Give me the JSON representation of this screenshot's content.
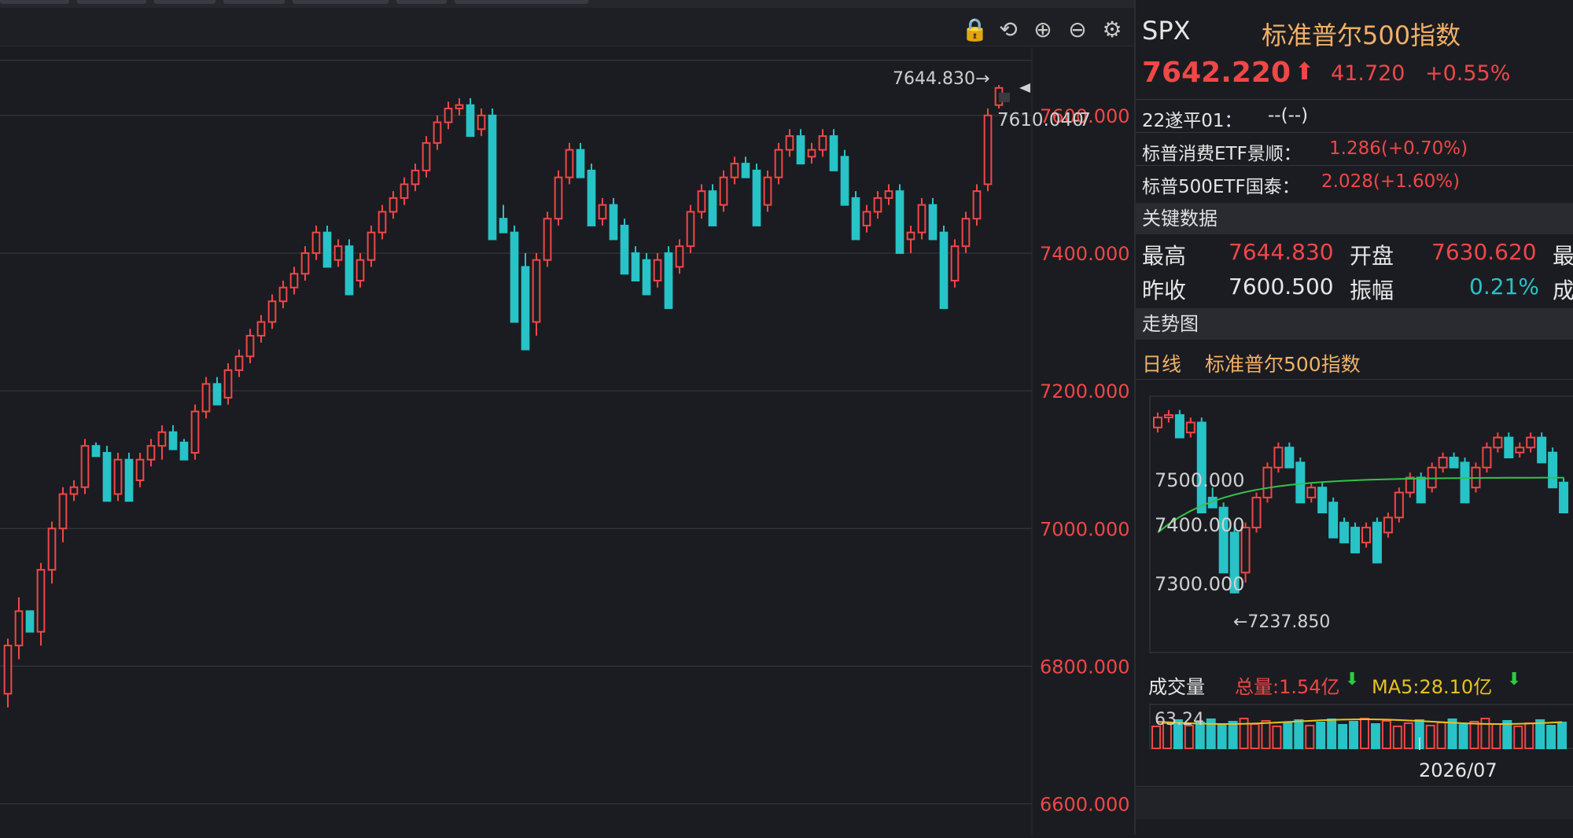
{
  "toolbar": {
    "icons": [
      "lock-icon",
      "undo-icon",
      "zoom-in-icon",
      "zoom-out-icon",
      "gear-icon"
    ],
    "lock_glyph": "🔒",
    "undo_glyph": "⟲",
    "zoom_in_glyph": "⊕",
    "zoom_out_glyph": "⊖",
    "gear_glyph": "⚙"
  },
  "chart_data": {
    "type": "candlestick",
    "y_axis_ticks": [
      "7600.000",
      "7400.000",
      "7200.000",
      "7000.000",
      "6800.000",
      "6600.000"
    ],
    "ylim": [
      6555,
      7690
    ],
    "grid": true,
    "high_marker_label": "7644.830→",
    "last_price_tag": "7610.040",
    "last_price_tag_suffix": "-7",
    "colors": {
      "up": "#f04747",
      "down": "#27c3c7",
      "grid": "#3a3b40",
      "axis_text": "#f04747"
    },
    "ohlc": [
      [
        6760,
        6840,
        6740,
        6830
      ],
      [
        6830,
        6900,
        6810,
        6880
      ],
      [
        6880,
        6860,
        6870,
        6850
      ],
      [
        6850,
        6950,
        6830,
        6940
      ],
      [
        6940,
        7010,
        6920,
        7000
      ],
      [
        7000,
        7060,
        6980,
        7050
      ],
      [
        7050,
        7070,
        7040,
        7060
      ],
      [
        7060,
        7130,
        7050,
        7120
      ],
      [
        7120,
        7110,
        7125,
        7105
      ],
      [
        7110,
        7050,
        7120,
        7040
      ],
      [
        7050,
        7110,
        7040,
        7100
      ],
      [
        7100,
        7060,
        7110,
        7040
      ],
      [
        7070,
        7110,
        7060,
        7100
      ],
      [
        7100,
        7130,
        7090,
        7120
      ],
      [
        7120,
        7150,
        7100,
        7140
      ],
      [
        7140,
        7125,
        7150,
        7115
      ],
      [
        7125,
        7110,
        7130,
        7100
      ],
      [
        7110,
        7180,
        7100,
        7170
      ],
      [
        7170,
        7220,
        7160,
        7210
      ],
      [
        7210,
        7190,
        7220,
        7180
      ],
      [
        7190,
        7240,
        7180,
        7230
      ],
      [
        7230,
        7260,
        7220,
        7250
      ],
      [
        7250,
        7290,
        7240,
        7280
      ],
      [
        7280,
        7310,
        7270,
        7300
      ],
      [
        7300,
        7340,
        7290,
        7330
      ],
      [
        7330,
        7360,
        7320,
        7350
      ],
      [
        7350,
        7380,
        7340,
        7370
      ],
      [
        7370,
        7410,
        7360,
        7400
      ],
      [
        7400,
        7440,
        7390,
        7430
      ],
      [
        7430,
        7390,
        7440,
        7380
      ],
      [
        7390,
        7420,
        7380,
        7410
      ],
      [
        7410,
        7360,
        7420,
        7340
      ],
      [
        7360,
        7400,
        7350,
        7390
      ],
      [
        7390,
        7440,
        7380,
        7430
      ],
      [
        7430,
        7470,
        7420,
        7460
      ],
      [
        7460,
        7490,
        7450,
        7480
      ],
      [
        7480,
        7510,
        7470,
        7500
      ],
      [
        7500,
        7530,
        7490,
        7520
      ],
      [
        7520,
        7570,
        7510,
        7560
      ],
      [
        7560,
        7600,
        7550,
        7590
      ],
      [
        7590,
        7620,
        7580,
        7610
      ],
      [
        7610,
        7625,
        7600,
        7615
      ],
      [
        7615,
        7580,
        7625,
        7570
      ],
      [
        7580,
        7610,
        7570,
        7600
      ],
      [
        7600,
        7450,
        7610,
        7420
      ],
      [
        7450,
        7470,
        7440,
        7430
      ],
      [
        7430,
        7380,
        7440,
        7300
      ],
      [
        7380,
        7300,
        7400,
        7260
      ],
      [
        7300,
        7400,
        7280,
        7390
      ],
      [
        7390,
        7460,
        7380,
        7450
      ],
      [
        7450,
        7520,
        7440,
        7510
      ],
      [
        7510,
        7560,
        7500,
        7550
      ],
      [
        7550,
        7520,
        7560,
        7510
      ],
      [
        7520,
        7450,
        7530,
        7440
      ],
      [
        7450,
        7480,
        7440,
        7470
      ],
      [
        7470,
        7440,
        7480,
        7420
      ],
      [
        7440,
        7400,
        7450,
        7370
      ],
      [
        7400,
        7380,
        7410,
        7360
      ],
      [
        7390,
        7360,
        7400,
        7340
      ],
      [
        7360,
        7400,
        7350,
        7390
      ],
      [
        7400,
        7380,
        7410,
        7320
      ],
      [
        7380,
        7420,
        7370,
        7410
      ],
      [
        7410,
        7470,
        7400,
        7460
      ],
      [
        7460,
        7500,
        7450,
        7490
      ],
      [
        7490,
        7470,
        7500,
        7440
      ],
      [
        7470,
        7520,
        7460,
        7510
      ],
      [
        7510,
        7540,
        7500,
        7530
      ],
      [
        7530,
        7520,
        7540,
        7510
      ],
      [
        7520,
        7470,
        7530,
        7440
      ],
      [
        7470,
        7520,
        7460,
        7510
      ],
      [
        7510,
        7560,
        7500,
        7550
      ],
      [
        7550,
        7580,
        7540,
        7570
      ],
      [
        7570,
        7540,
        7580,
        7530
      ],
      [
        7540,
        7560,
        7530,
        7550
      ],
      [
        7550,
        7580,
        7540,
        7570
      ],
      [
        7570,
        7540,
        7580,
        7520
      ],
      [
        7540,
        7480,
        7550,
        7470
      ],
      [
        7480,
        7440,
        7490,
        7420
      ],
      [
        7440,
        7470,
        7430,
        7460
      ],
      [
        7460,
        7490,
        7450,
        7480
      ],
      [
        7480,
        7500,
        7470,
        7490
      ],
      [
        7490,
        7420,
        7500,
        7400
      ],
      [
        7420,
        7440,
        7400,
        7430
      ],
      [
        7430,
        7480,
        7420,
        7470
      ],
      [
        7470,
        7430,
        7480,
        7420
      ],
      [
        7430,
        7360,
        7440,
        7320
      ],
      [
        7360,
        7420,
        7350,
        7410
      ],
      [
        7410,
        7460,
        7400,
        7450
      ],
      [
        7450,
        7500,
        7440,
        7490
      ],
      [
        7500,
        7610,
        7490,
        7600
      ],
      [
        7615,
        7644,
        7610,
        7640
      ]
    ]
  },
  "panel": {
    "symbol": "SPX",
    "name": "标准普尔500指数",
    "price": "7642.220",
    "up_arrow": "⬆",
    "change": "41.720",
    "change_pct": "+0.55%",
    "related": [
      {
        "label": "22遂平01：",
        "value": "--(--)"
      },
      {
        "label": "标普消费ETF景顺：",
        "value": "1.286(+0.70%)"
      },
      {
        "label": "标普500ETF国泰：",
        "value": "2.028(+1.60%)"
      }
    ],
    "key_data_title": "关键数据",
    "key_data": {
      "high_label": "最高",
      "high_value": "7644.830",
      "open_label": "开盘",
      "open_value": "7630.620",
      "prev_close_label": "昨收",
      "prev_close_value": "7600.500",
      "amplitude_label": "振幅",
      "amplitude_value": "0.21%",
      "cut_label_1": "最",
      "cut_label_2": "成"
    },
    "trend_title": "走势图",
    "trend_period": "日线",
    "trend_name": "标准普尔500指数",
    "mini_chart": {
      "y_labels": [
        "7500.000",
        "7400.000",
        "7300.000"
      ],
      "low_label": "←7237.850"
    },
    "volume": {
      "title": "成交量",
      "total_label": "总量:1.54亿",
      "ma5_label": "MA5:28.10亿",
      "arrow": "⬇",
      "max_label": "63.24",
      "date_label": "2026/07"
    }
  }
}
